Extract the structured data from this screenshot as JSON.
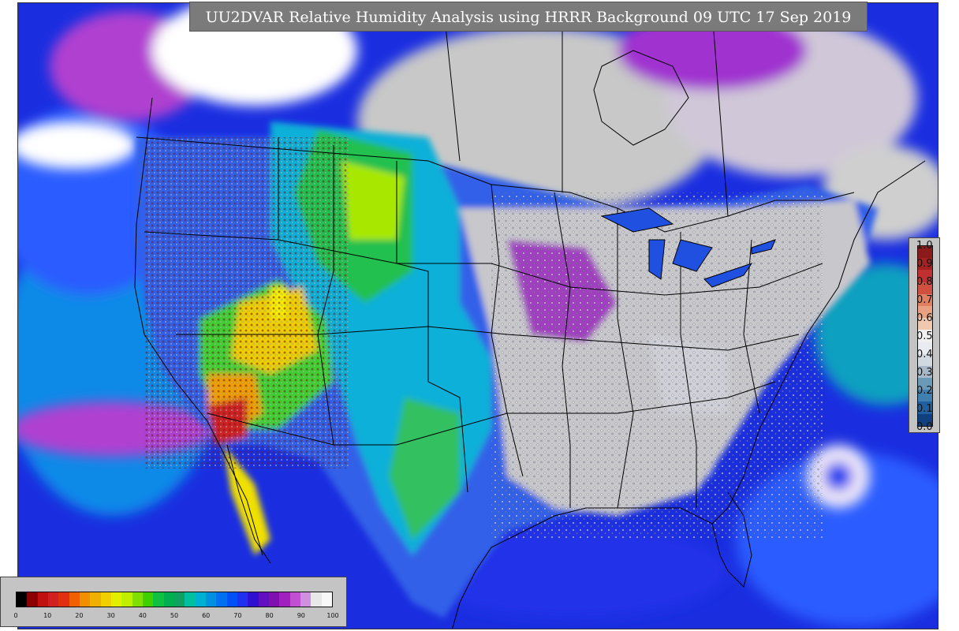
{
  "title": "UU2DVAR Relative Humidity Analysis using HRRR Background 09 UTC 17 Sep 2019",
  "colors": {
    "ocean_dark": "#1818c8",
    "ocean_mid": "#2a3cff",
    "ocean_light": "#0094e8",
    "cloud_gray": "#c8c8c8",
    "purple": "#9010b0",
    "magenta": "#c040e0",
    "land_blue": "#0060e0",
    "cyan": "#10b0e0",
    "green": "#10c040",
    "lime": "#80e000",
    "yellow": "#f0e000",
    "orange": "#f0a000",
    "red": "#d02020",
    "border_black": "#000000"
  },
  "rh_legend": {
    "colors": [
      "#000000",
      "#8b0000",
      "#c01010",
      "#d02020",
      "#e03010",
      "#f06000",
      "#f09000",
      "#f0b000",
      "#f0d000",
      "#e0f000",
      "#c0f000",
      "#80e000",
      "#40d000",
      "#10c040",
      "#00b050",
      "#10a060",
      "#00c0a0",
      "#00b0d0",
      "#0090e0",
      "#0070f0",
      "#0050f8",
      "#2030f0",
      "#3010d0",
      "#6010c0",
      "#8010b0",
      "#a020c0",
      "#c050d0",
      "#d090e0",
      "#e8e8e8",
      "#f8f8f8"
    ],
    "ticks": [
      "0",
      "10",
      "20",
      "30",
      "40",
      "50",
      "60",
      "70",
      "80",
      "90",
      "100"
    ]
  },
  "obs_legend": {
    "colors": [
      "#8b1a1a",
      "#a52020",
      "#c03030",
      "#d05040",
      "#e08060",
      "#e8a080",
      "#f0c8b0",
      "#f0f0f0",
      "#e8ecf0",
      "#d0d8e0",
      "#a8b8c8",
      "#6a9ab8",
      "#4080b0",
      "#2060a0",
      "#104080"
    ],
    "ticks": [
      "1.0",
      "0.9",
      "0.8",
      "0.7",
      "0.6",
      "0.5",
      "0.4",
      "0.3",
      "0.2",
      "0.1",
      "0.0"
    ]
  }
}
